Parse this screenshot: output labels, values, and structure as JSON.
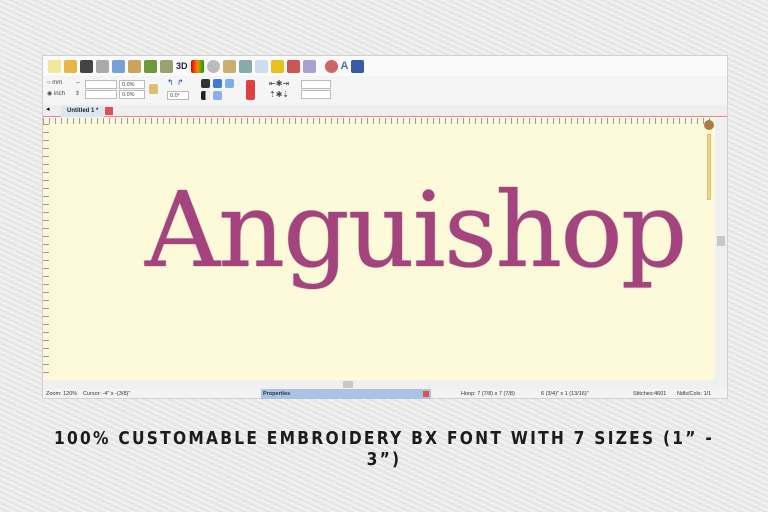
{
  "toolbar": {
    "icons": [
      "new-file-icon",
      "open-folder-icon",
      "save-icon",
      "print-icon",
      "copy-icon",
      "paste-icon",
      "rotate-icon",
      "mirror-icon",
      "3d-view-icon",
      "color-bars-icon",
      "zoom-icon",
      "measure-icon",
      "hoop-icon",
      "hand-icon",
      "frame-icon",
      "needle-icon",
      "pattern-icon",
      "settings-icon",
      "text-icon",
      "export-icon"
    ],
    "label_3d": "3D",
    "label_text": "A"
  },
  "options": {
    "unit_mm": "mm",
    "unit_inch": "inch",
    "selected_unit": "inch",
    "width_pct": "0.0%",
    "height_pct": "0.0%",
    "rotation": "0.0°"
  },
  "tabs": [
    {
      "label": "Untitled 1 *"
    }
  ],
  "design": {
    "text": "Anguishop",
    "color": "#a3447e"
  },
  "status": {
    "zoom": "Zoom: 120%",
    "cursor": "Cursor: -4\" x -(3/8)\"",
    "properties": "Properties",
    "hoop": "Hoop: 7 (7/8) x 7 (7/8)",
    "size": "6 (3/4)\" x 1 (13/16)\"",
    "stitches": "Stitches:4601",
    "ndls": "Ndls/Cols: 1/1"
  },
  "caption": "100% CUSTOMABLE EMBROIDERY BX FONT WITH 7 SIZES (1” -  3”)"
}
